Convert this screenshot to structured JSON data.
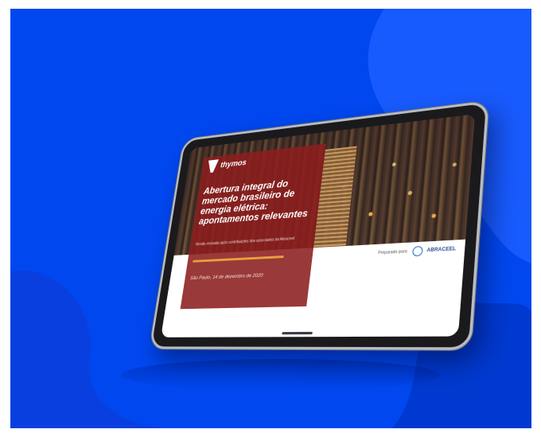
{
  "colors": {
    "background": "#0047f0",
    "overlay_red": "#8c1e1e",
    "accent_bar": "#e8a13a",
    "tablet_frame": "#b9bcc3"
  },
  "slide": {
    "logo_text": "thymos",
    "title": "Abertura integral do mercado brasileiro de energia elétrica: apontamentos relevantes",
    "subtitle": "Versão revisada após contribuições dos associados da Abraceel",
    "date": "São Paulo, 14 de dezembro de 2020",
    "prepared_label": "Preparado para:",
    "client_name": "ABRACEEL"
  }
}
